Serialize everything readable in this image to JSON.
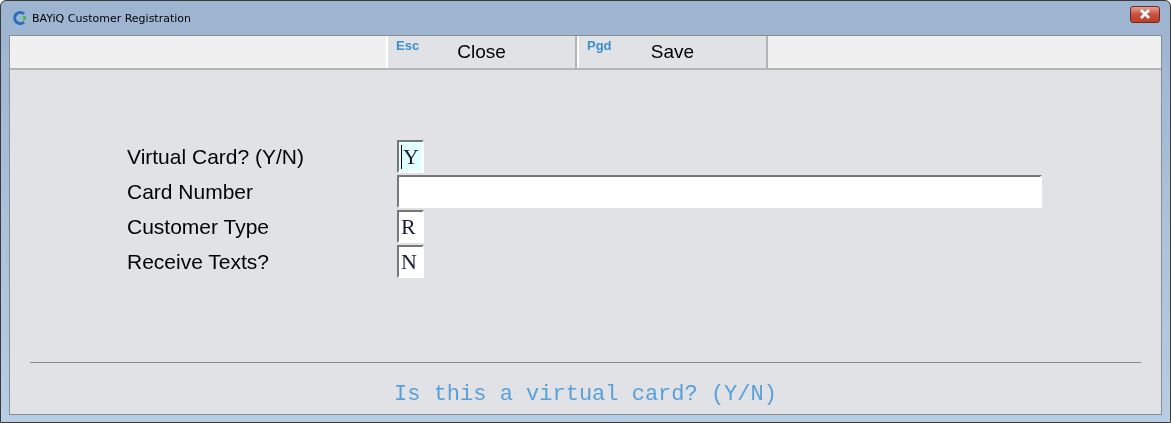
{
  "window": {
    "title": "BAYiQ Customer Registration"
  },
  "toolbar": [
    {
      "key": "Esc",
      "label": "Close"
    },
    {
      "key": "Pgd",
      "label": "Save"
    }
  ],
  "fields": [
    {
      "label": "Virtual Card? (Y/N)",
      "value": "Y",
      "kind": "short",
      "focused": true
    },
    {
      "label": "Card Number",
      "kind": "long",
      "focused": false
    },
    {
      "label": "Customer Type",
      "value": "R",
      "kind": "short",
      "focused": false
    },
    {
      "label": "Receive Texts?",
      "value": "N",
      "kind": "short",
      "focused": false
    }
  ],
  "prompt": "Is this a virtual card? (Y/N)"
}
